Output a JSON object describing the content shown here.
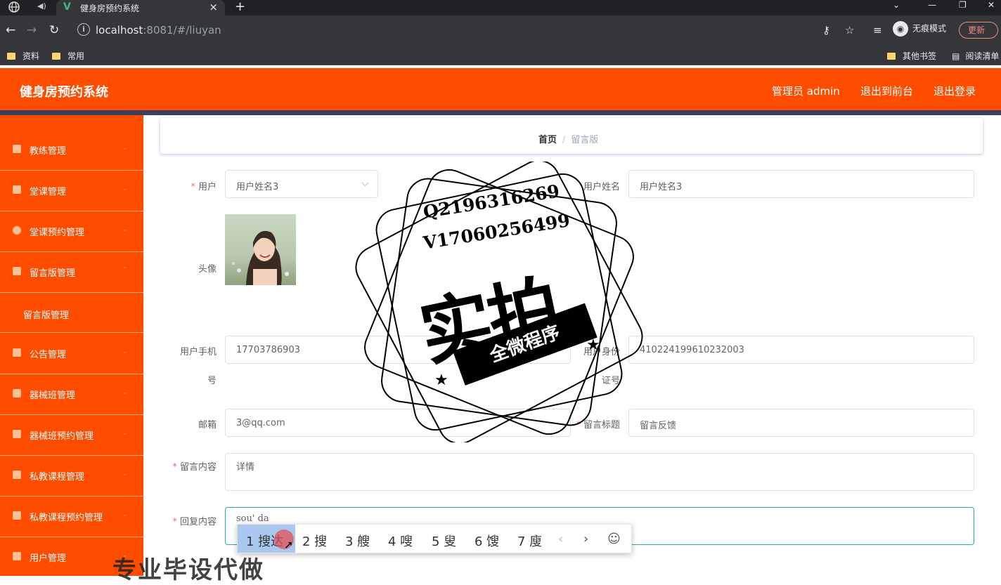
{
  "browser": {
    "tab_title": "健身房预约系统",
    "url_host": "localhost",
    "url_rest": ":8081/#/liuyan",
    "incognito_label": "无痕模式",
    "update_label": "更新",
    "bookmarks": [
      "资料",
      "常用"
    ],
    "bookmarks_right": [
      "其他书签",
      "阅读清单"
    ]
  },
  "header": {
    "title": "健身房预约系统",
    "admin": "管理员 admin",
    "to_front": "退出到前台",
    "logout": "退出登录"
  },
  "sidebar": {
    "items": [
      {
        "label": "教练管理"
      },
      {
        "label": "堂课管理"
      },
      {
        "label": "堂课预约管理"
      },
      {
        "label": "留言版管理"
      },
      {
        "label": "公告管理"
      },
      {
        "label": "器械班管理"
      },
      {
        "label": "器械班预约管理"
      },
      {
        "label": "私教课程管理"
      },
      {
        "label": "私教课程预约管理"
      },
      {
        "label": "用户管理"
      }
    ],
    "submenu_label": "留言版管理"
  },
  "breadcrumb": {
    "home": "首页",
    "sep": "/",
    "current": "留言版"
  },
  "form": {
    "user_label": "用户",
    "user_value": "用户姓名3",
    "username_label": "用户姓名",
    "username_value": "用户姓名3",
    "avatar_label": "头像",
    "phone_label_1": "用户手机",
    "phone_label_2": "号",
    "phone_value": "17703786903",
    "idcard_label_1": "用户身份",
    "idcard_label_2": "证号",
    "idcard_value": "410224199610232003",
    "email_label": "邮箱",
    "email_value": "3@qq.com",
    "title_label": "留言标题",
    "title_value": "留言反馈",
    "content_label": "留言内容",
    "content_value": "详情",
    "reply_label": "回复内容",
    "reply_value": "sou' da"
  },
  "ime": {
    "candidates": [
      "1 搜达",
      "2 搜",
      "3 艘",
      "4 嗖",
      "5 叟",
      "6 馊",
      "7 廋"
    ]
  },
  "watermark": {
    "line1": "Q2196316269",
    "line2": "V1706025649​9",
    "big": "实拍",
    "ribbon": "全微程序",
    "bottom": "专业毕设代做"
  }
}
